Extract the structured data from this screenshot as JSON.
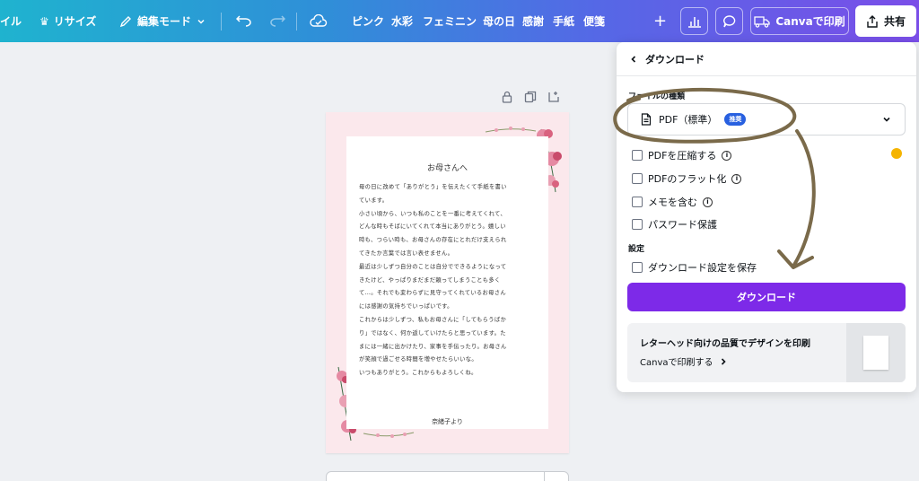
{
  "toolbar": {
    "file_label": "イル",
    "resize_label": "リサイズ",
    "edit_mode_label": "編集モード",
    "keywords": [
      "ピンク",
      "水彩",
      "フェミニン",
      "母の日",
      "感謝",
      "手紙",
      "便箋"
    ],
    "print_label": "Canvaで印刷",
    "share_label": "共有"
  },
  "letter": {
    "title": "お母さんへ",
    "lines": [
      "母の日に改めて「ありがとう」を伝えたくて手紙を書い",
      "ています。",
      "小さい頃から、いつも私のことを一番に考えてくれて、",
      "どんな時もそばにいてくれて本当にありがとう。嬉しい",
      "時も、つらい時も、お母さんの存在にとれだけ支えられ",
      "てきたか言葉では言い表せません。",
      "最近は少しずつ自分のことは自分でできるようになって",
      "きたけど、やっぱりまだまだ頼ってしまうことも多く",
      "て…。それでも変わらずに見守ってくれているお母さん",
      "には感謝の気持ちでいっぱいです。",
      "これからは少しずつ、私もお母さんに「してもらうばか",
      "り」ではなく、何か返していけたらと思っています。た",
      "まには一緒に出かけたり、家事を手伝ったり。お母さん",
      "が笑顔で過ごせる時間を増やせたらいいな。",
      "いつもありがとう。これからもよろしくね。"
    ],
    "signature": "奈緒子より"
  },
  "panel": {
    "back_title": "ダウンロード",
    "file_type_label": "ファイルの種類",
    "file_type_value": "PDF（標準）",
    "recommended_badge": "推奨",
    "options": [
      "PDFを圧縮する",
      "PDFのフラット化",
      "メモを含む",
      "パスワード保護"
    ],
    "settings_label": "設定",
    "save_settings_label": "ダウンロード設定を保存",
    "download_button": "ダウンロード",
    "promo_title": "レターヘッド向けの品質でデザインを印刷",
    "promo_link": "Canvaで印刷する"
  },
  "colors": {
    "accent": "#7d2ae8",
    "badge": "#2860e0",
    "annotation": "#7a6a4a",
    "page_background": "#fbe8ec"
  }
}
